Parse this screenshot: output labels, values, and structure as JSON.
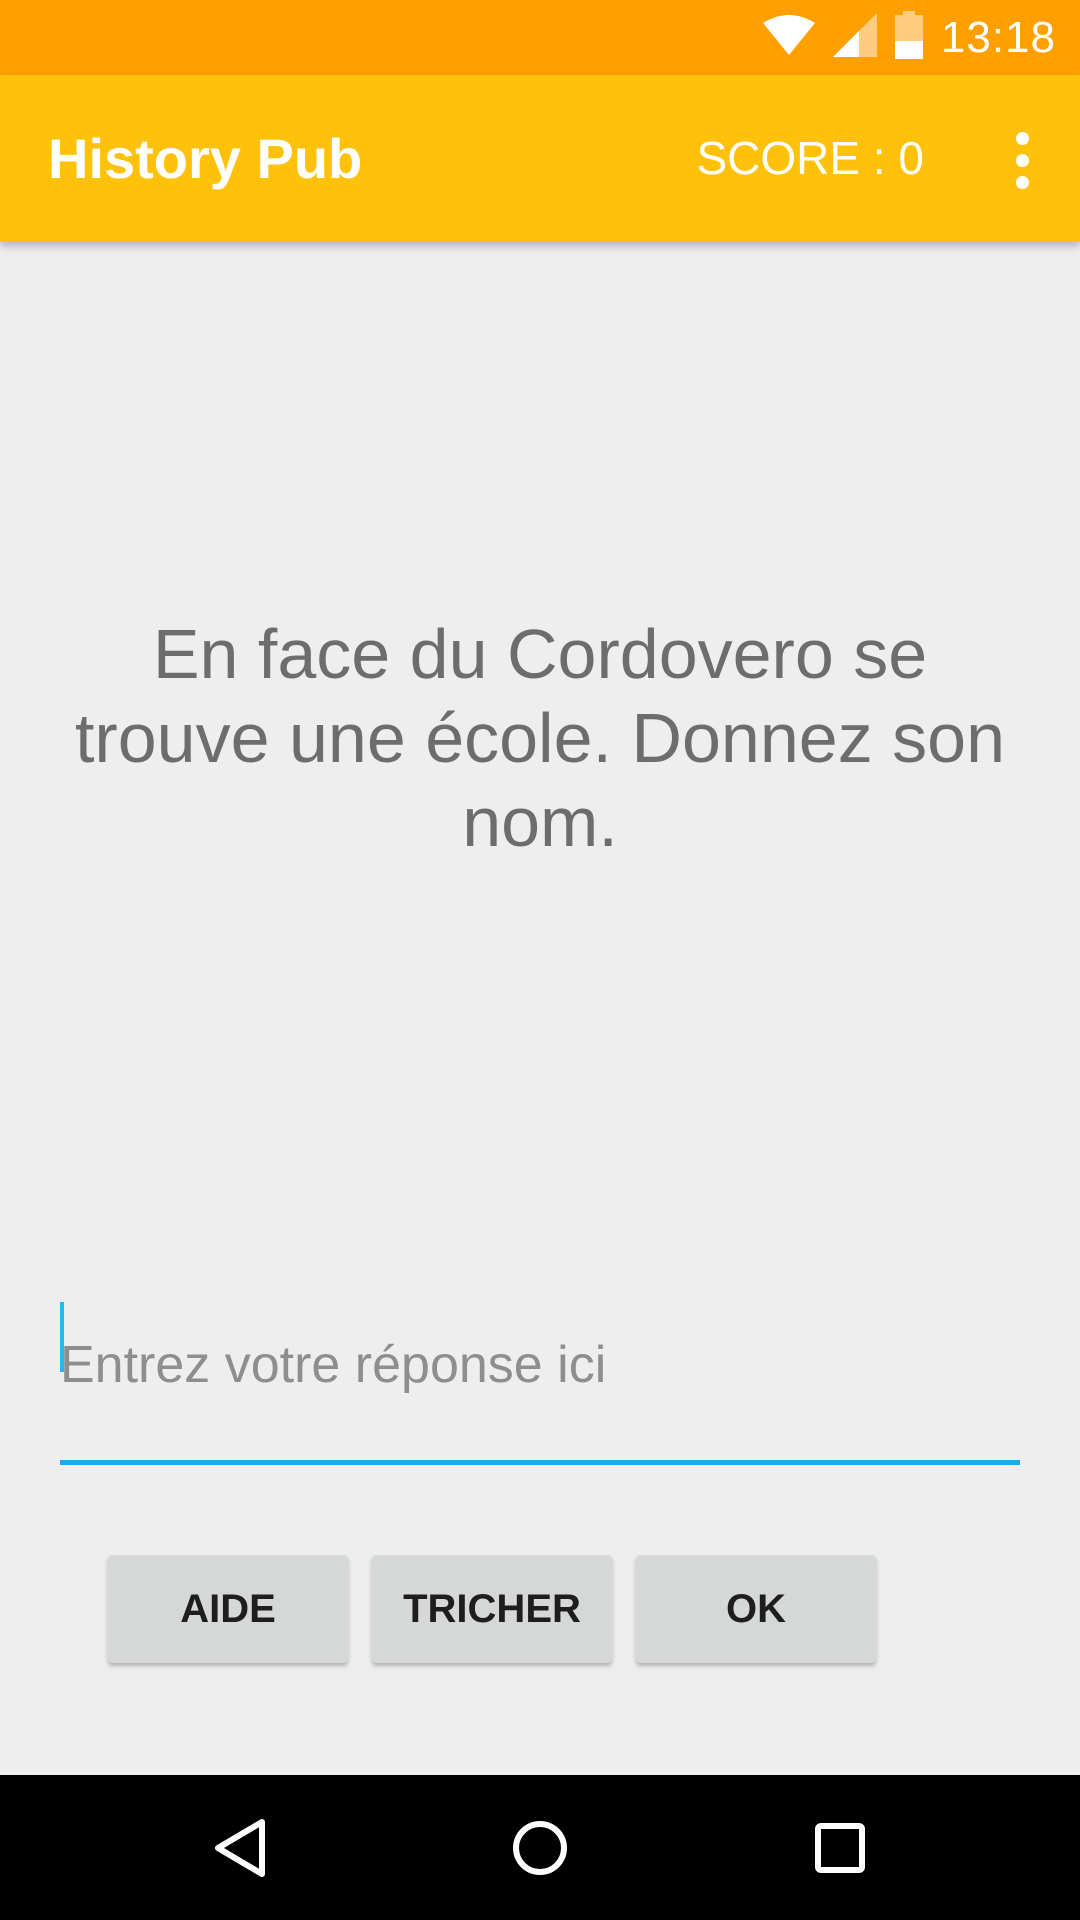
{
  "status_bar": {
    "time": "13:18",
    "icons": [
      "wifi-icon",
      "cell-signal-icon",
      "battery-icon"
    ],
    "color": "#ffa000"
  },
  "app_bar": {
    "title": "History Pub",
    "score": "SCORE : 0",
    "menu_icon": "more-vert-icon",
    "color": "#ffc10a"
  },
  "main": {
    "question": "En face du Cordovero se trouve une école. Donnez son nom.",
    "answer": {
      "value": "",
      "placeholder": "Entrez votre réponse ici",
      "accent": "#1eaaf1"
    },
    "buttons": {
      "help": "AIDE",
      "cheat": "TRICHER",
      "ok": "OK"
    }
  },
  "nav_bar": {
    "icons": [
      "back-icon",
      "home-icon",
      "recents-icon"
    ]
  }
}
